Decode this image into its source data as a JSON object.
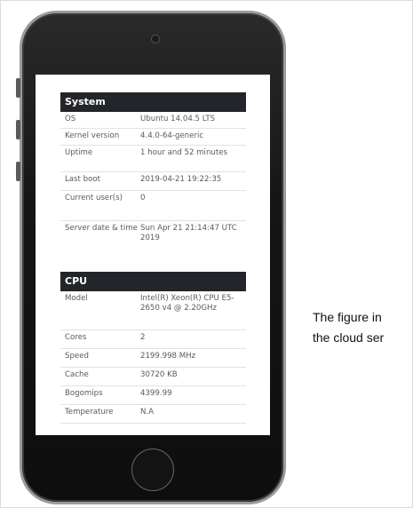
{
  "system": {
    "title": "System",
    "rows": [
      {
        "label": "OS",
        "value": "Ubuntu 14.04.5 LTS"
      },
      {
        "label": "Kernel version",
        "value": "4.4.0-64-generic"
      },
      {
        "label": "Uptime",
        "value": "1 hour and 52 minutes"
      },
      {
        "label": "Last boot",
        "value": "2019-04-21 19:22:35"
      },
      {
        "label": "Current user(s)",
        "value": "0"
      },
      {
        "label": "Server date & time",
        "value": "Sun Apr 21 21:14:47 UTC 2019"
      }
    ]
  },
  "cpu": {
    "title": "CPU",
    "rows": [
      {
        "label": "Model",
        "value": "Intel(R) Xeon(R) CPU E5-2650 v4 @ 2.20GHz"
      },
      {
        "label": "Cores",
        "value": "2"
      },
      {
        "label": "Speed",
        "value": "2199.998 MHz"
      },
      {
        "label": "Cache",
        "value": "30720 KB"
      },
      {
        "label": "Bogomips",
        "value": "4399.99"
      },
      {
        "label": "Temperature",
        "value": "N.A"
      }
    ]
  },
  "caption": {
    "line1": "The figure in",
    "line2": "the cloud ser"
  }
}
